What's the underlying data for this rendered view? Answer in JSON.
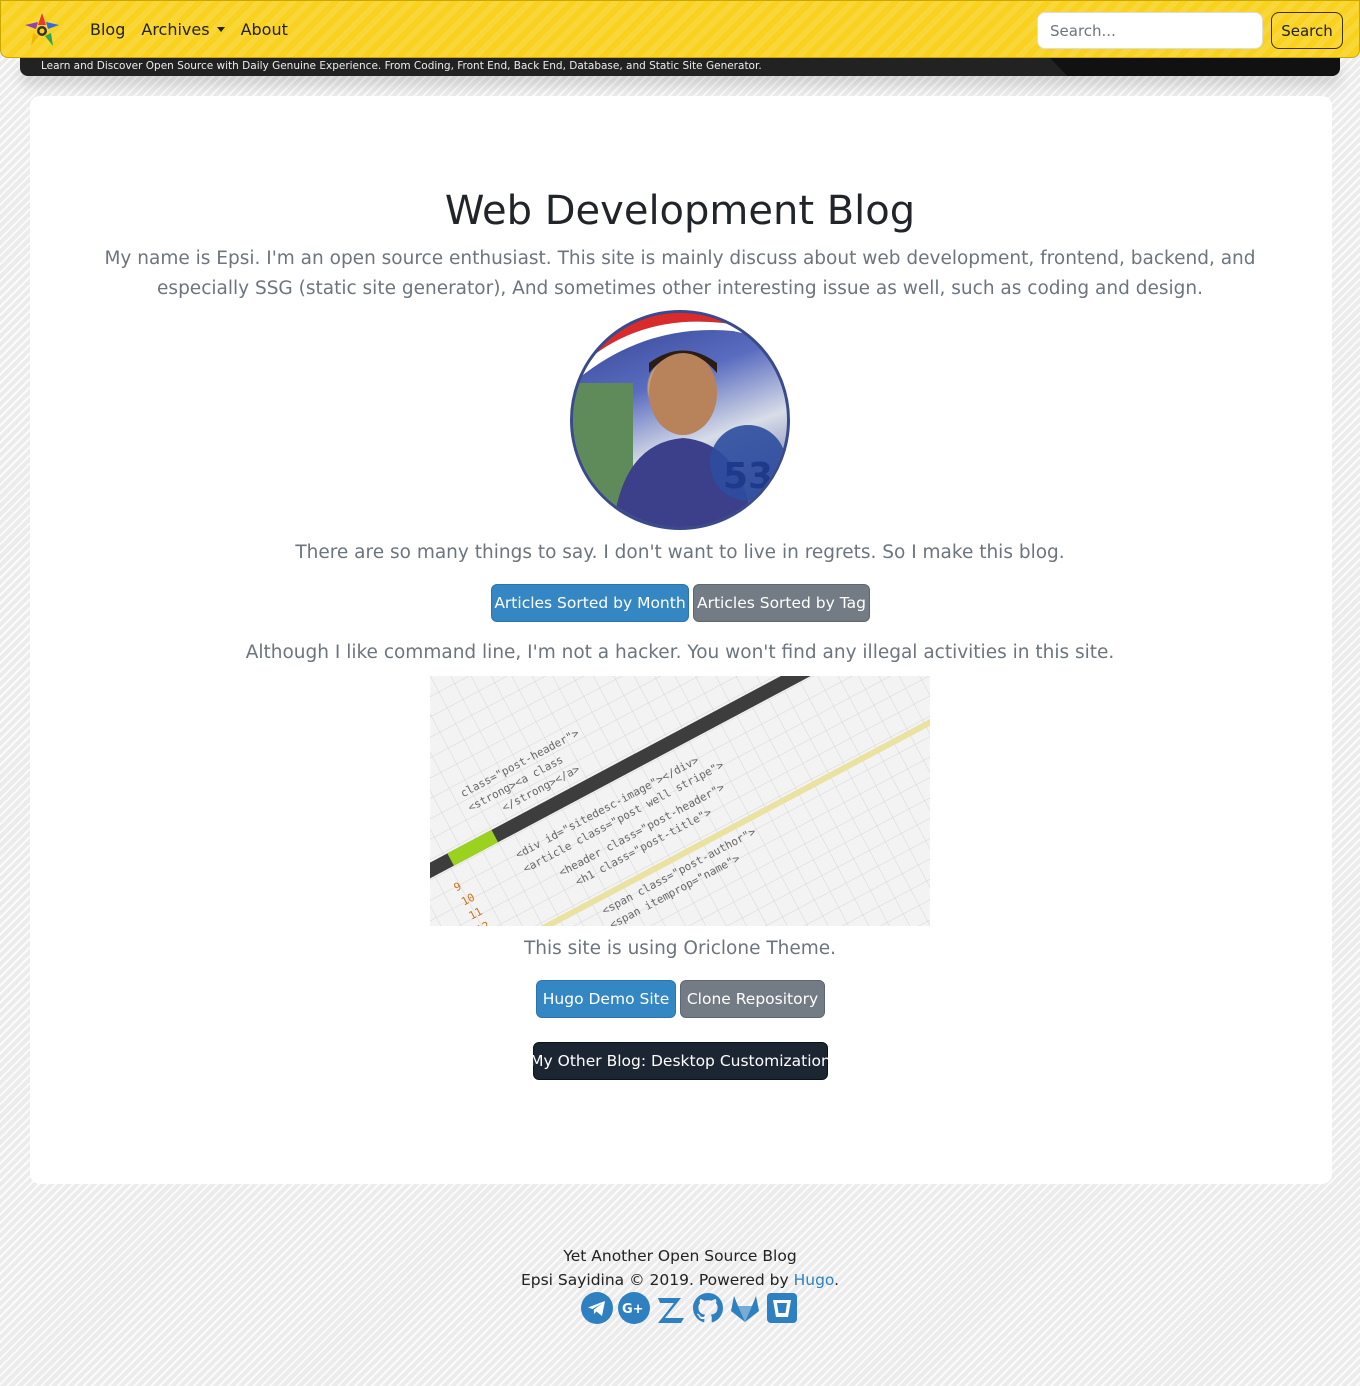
{
  "nav": {
    "links": [
      "Blog",
      "Archives",
      "About"
    ],
    "search": {
      "placeholder": "Search...",
      "button": "Search"
    }
  },
  "tagline": "Learn and Discover Open Source with Daily Genuine Experience. From Coding, Front End, Back End, Database, and Static Site Generator.",
  "main": {
    "title": "Web Development Blog",
    "intro": "My name is Epsi. I'm an open source enthusiast. This site is mainly discuss about web development, frontend, backend, and especially SSG (static site generator), And sometimes other interesting issue as well, such as coding and design.",
    "regrets": "There are so many things to say. I don't want to live in regrets. So I make this blog.",
    "buttons_articles": [
      "Articles Sorted by Month",
      "Articles Sorted by Tag"
    ],
    "hacker": "Although I like command line, I'm not a hacker. You won't find any illegal activities in this site.",
    "theme": "This site is using Oriclone Theme.",
    "buttons_theme": [
      "Hugo Demo Site",
      "Clone Repository"
    ],
    "other_blog": "My Other Blog: Desktop Customization"
  },
  "footer": {
    "line1": "Yet Another Open Source Blog",
    "line2_prefix": "Epsi Sayidina © 2019. Powered by",
    "powered_link": "Hugo",
    "line2_suffix": ".",
    "socials": [
      "telegram-icon",
      "google-plus-icon",
      "zhihu-icon",
      "github-icon",
      "gitlab-icon",
      "bitbucket-icon"
    ]
  },
  "colors": {
    "navbar": "#f8d21f",
    "primary": "#3587c4",
    "secondary": "#737b84",
    "dark": "#1c2633",
    "social": "#2f80c0"
  }
}
